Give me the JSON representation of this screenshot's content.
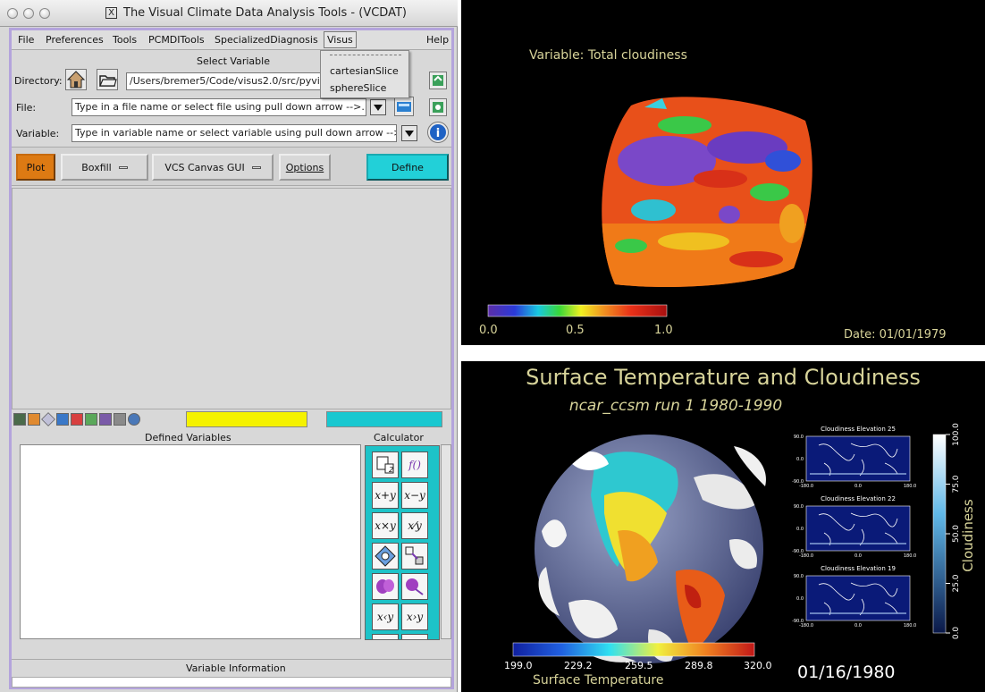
{
  "window": {
    "title": "The Visual Climate Data Analysis Tools - (VCDAT)",
    "title_icon": "X"
  },
  "menubar": {
    "items": [
      "File",
      "Preferences",
      "Tools",
      "PCMDITools",
      "SpecializedDiagnosis",
      "Visus"
    ],
    "help": "Help",
    "active": "Visus"
  },
  "visus_menu": {
    "items": [
      "cartesianSlice",
      "sphereSlice"
    ]
  },
  "select_variable": {
    "heading": "Select Variable",
    "directory_label": "Directory:",
    "directory_value": "/Users/bremer5/Code/visus2.0/src/pyvisus",
    "file_label": "File:",
    "file_value": "Type in a file name or select file using pull down arrow -->.",
    "variable_label": "Variable:",
    "variable_value": "Type in variable name or select variable using pull down arrow -->."
  },
  "toolbar": {
    "plot": "Plot",
    "boxfill": "Boxfill",
    "vcs_canvas": "VCS Canvas GUI",
    "options": "Options",
    "define": "Define"
  },
  "defined_variables": {
    "heading": "Defined Variables"
  },
  "calculator": {
    "heading": "Calculator",
    "cells": [
      "f()",
      "x+y",
      "x−y",
      "x×y",
      "x⁄y",
      "x‹y",
      "x›y"
    ]
  },
  "variable_information": {
    "heading": "Variable Information"
  },
  "colors": {
    "plot_button": "#dd7a13",
    "define_button": "#22d0d8",
    "calculator_bg": "#1dc3c8",
    "yellow_box": "#f5f200",
    "window_frame": "#b4a4dc",
    "label_yellow": "#d8d49a"
  },
  "top_panel": {
    "variable_label": "Variable: Total cloudiness",
    "date_label": "Date: 01/01/1979",
    "colorbar_ticks": [
      "0.0",
      "0.5",
      "1.0"
    ]
  },
  "bottom_panel": {
    "title": "Surface Temperature and Cloudiness",
    "subtitle": "ncar_ccsm run 1 1980-1990",
    "date": "01/16/1980",
    "colorbar_label": "Surface Temperature",
    "colorbar_ticks": [
      "199.0",
      "229.2",
      "259.5",
      "289.8",
      "320.0"
    ],
    "side_colorbar_label": "Cloudiness",
    "side_colorbar_ticks": [
      "100.0",
      "75.0",
      "50.0",
      "25.0",
      "0.0"
    ],
    "maps": [
      {
        "title": "Cloudiness Elevation 25"
      },
      {
        "title": "Cloudiness Elevation 22"
      },
      {
        "title": "Cloudiness Elevation 19"
      }
    ],
    "map_y_ticks": [
      "90.0",
      "0.0",
      "-90.0"
    ],
    "map_x_ticks": [
      "-180.0",
      "0.0",
      "180.0"
    ]
  }
}
